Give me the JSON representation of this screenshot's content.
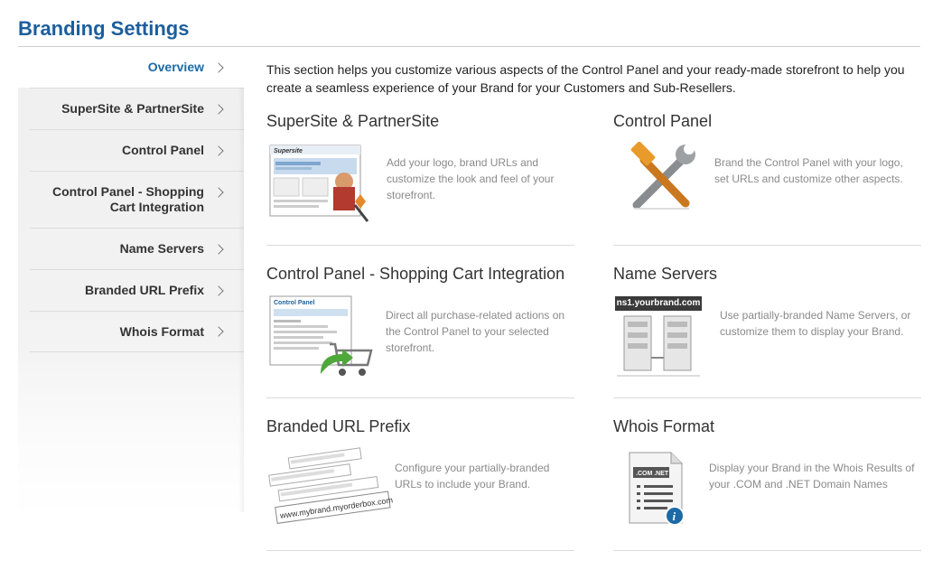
{
  "page": {
    "title": "Branding Settings"
  },
  "sidebar": {
    "items": [
      {
        "label": "Overview",
        "active": true
      },
      {
        "label": "SuperSite & PartnerSite"
      },
      {
        "label": "Control Panel"
      },
      {
        "label": "Control Panel - Shopping Cart Integration"
      },
      {
        "label": "Name Servers"
      },
      {
        "label": "Branded URL Prefix"
      },
      {
        "label": "Whois Format"
      }
    ]
  },
  "main": {
    "intro": "This section helps you customize various aspects of the Control Panel and your ready-made storefront to help you create a seamless experience of your Brand for your Customers and Sub-Resellers.",
    "cards": [
      {
        "title": "SuperSite & PartnerSite",
        "description": "Add your logo, brand URLs and customize the look and feel of your storefront.",
        "image_text": "Supersite",
        "icon": "storefront-screenshot-icon"
      },
      {
        "title": "Control Panel",
        "description": "Brand the Control Panel with your logo, set URLs and customize other aspects.",
        "icon": "wrench-hammer-icon"
      },
      {
        "title": "Control Panel - Shopping Cart Integration",
        "description": "Direct all purchase-related actions on the Control Panel to your selected storefront.",
        "image_text": "Control Panel",
        "icon": "shopping-cart-icon"
      },
      {
        "title": "Name Servers",
        "description": "Use partially-branded Name Servers, or customize them to display your Brand.",
        "image_text": "ns1.yourbrand.com",
        "icon": "servers-icon"
      },
      {
        "title": "Branded URL Prefix",
        "description": "Configure your partially-branded URLs to include your Brand.",
        "image_text": "www.mybrand.myorderbox.com",
        "icon": "url-strips-icon"
      },
      {
        "title": "Whois Format",
        "description": "Display your Brand in the Whois Results of your .COM and .NET Domain Names",
        "image_text": ".COM .NET",
        "icon": "whois-document-icon"
      }
    ]
  },
  "colors": {
    "title": "#1c5e9c",
    "active_nav": "#1c6aa6",
    "text": "#333333",
    "muted": "#8a8a8a",
    "rule": "#dcdcdc"
  }
}
